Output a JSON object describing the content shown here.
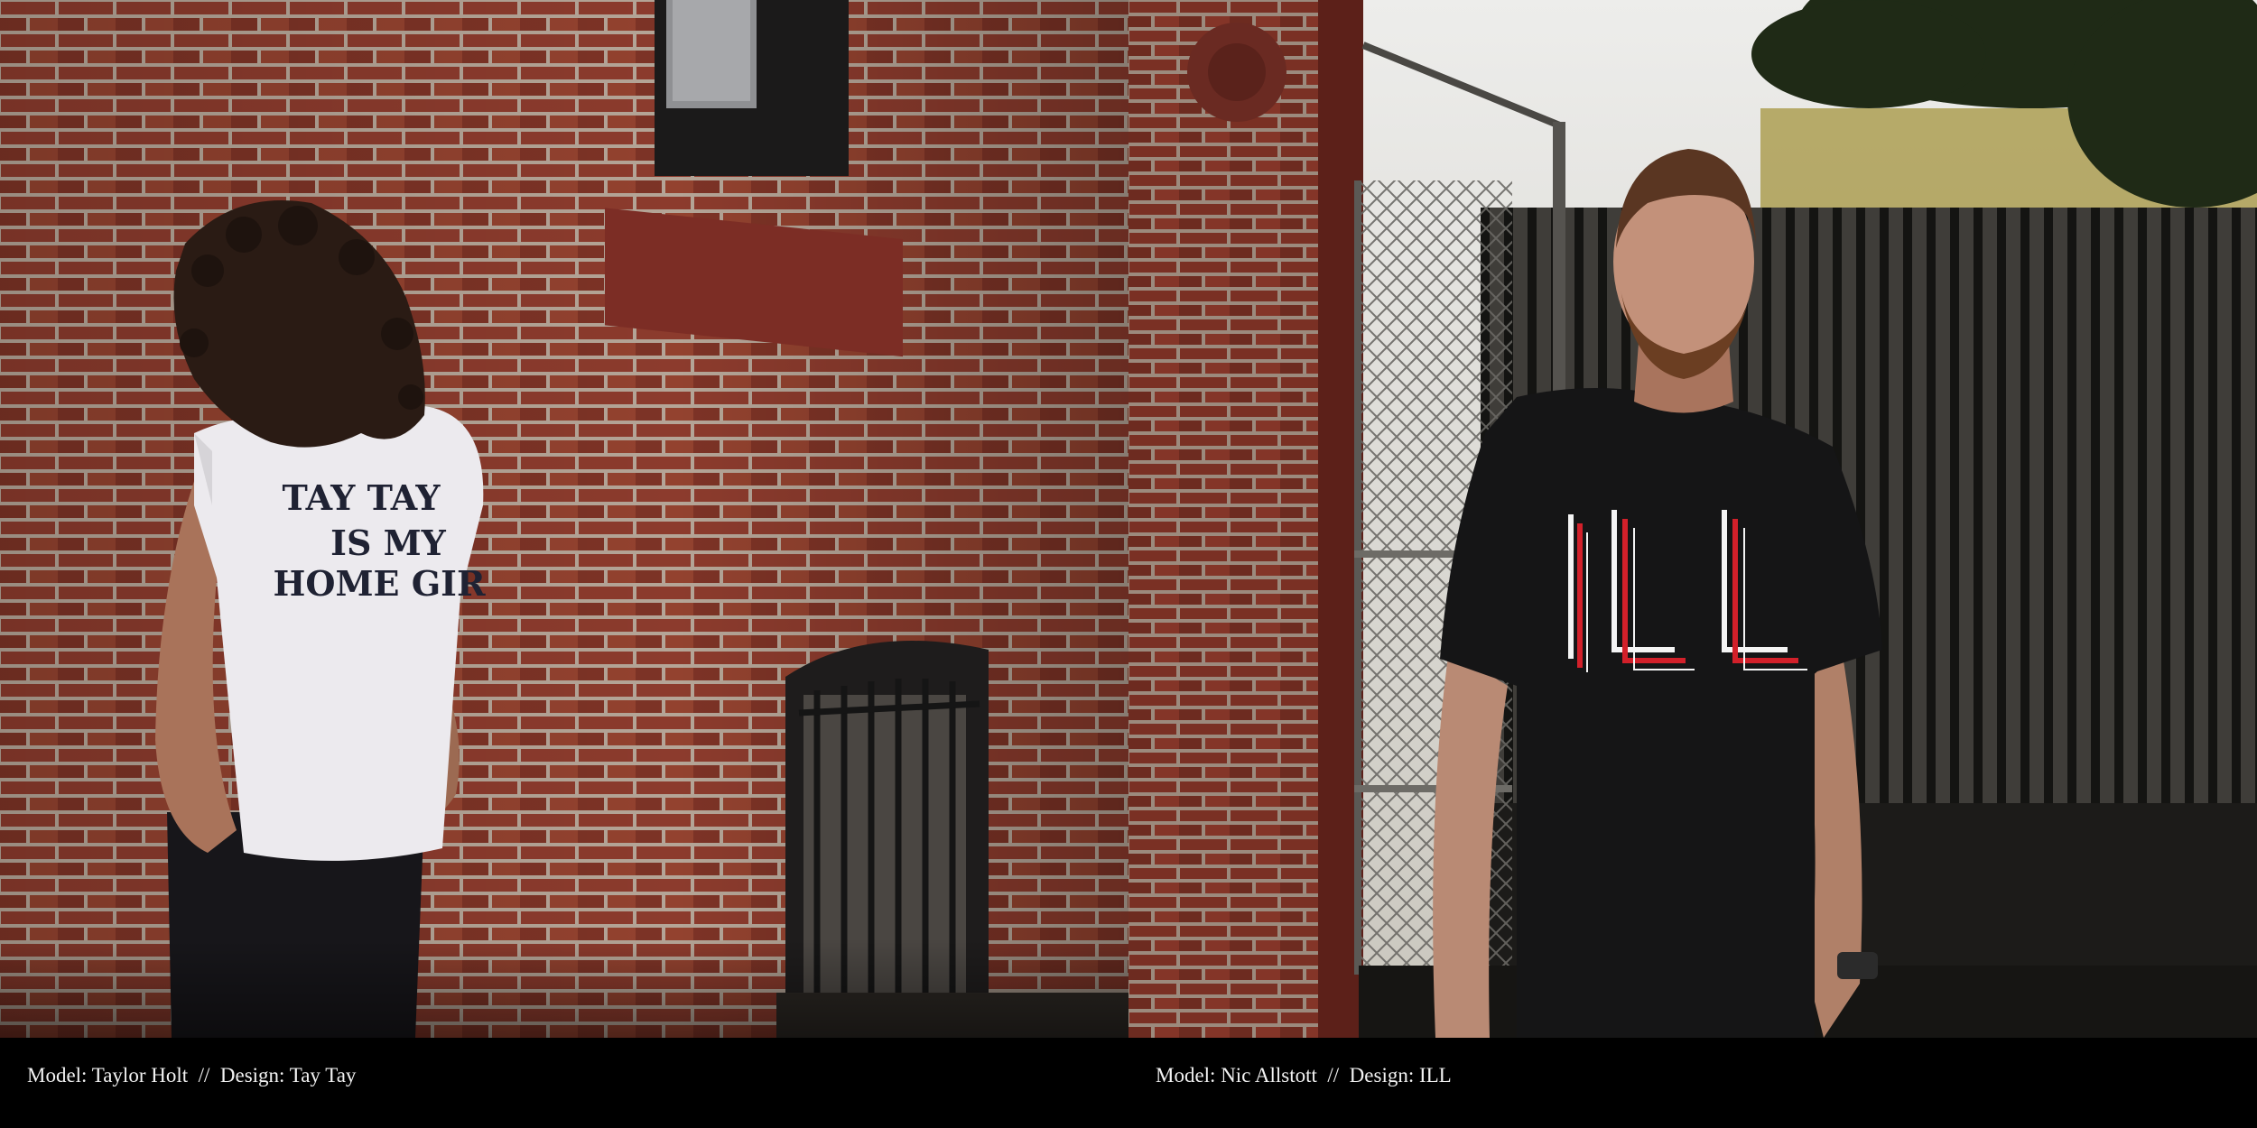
{
  "photos": [
    {
      "shirt_print": [
        "TAY TAY",
        "IS MY",
        "HOME GIR"
      ],
      "caption": "Model: Taylor Holt  //  Design: Tay Tay"
    },
    {
      "shirt_print": "ILL",
      "caption": "Model: Nic Allstott  //  Design: ILL"
    }
  ],
  "colors": {
    "brick": "#8a3a2c",
    "mortar": "#b8a898",
    "fence": "#1a1a18",
    "caption_bg": "#000000",
    "caption_text": "#f2f2f2",
    "ill_red": "#d2202a",
    "ill_white": "#f4f4f4"
  }
}
